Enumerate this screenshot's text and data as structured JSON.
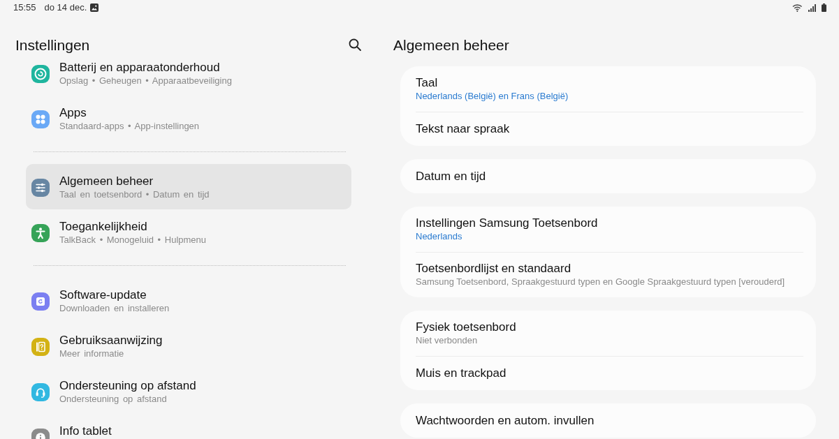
{
  "status_bar": {
    "time": "15:55",
    "date": "do 14 dec."
  },
  "sidebar": {
    "title": "Instellingen",
    "groups": [
      {
        "items": [
          {
            "title": "Batterij en apparaatonderhoud",
            "subtitle": "Opslag • Geheugen • Apparaatbeveiliging",
            "selected": false
          },
          {
            "title": "Apps",
            "subtitle": "Standaard-apps • App-instellingen",
            "selected": false
          }
        ]
      },
      {
        "items": [
          {
            "title": "Algemeen beheer",
            "subtitle": "Taal en toetsenbord • Datum en tijd",
            "selected": true
          },
          {
            "title": "Toegankelijkheid",
            "subtitle": "TalkBack • Monogeluid • Hulpmenu",
            "selected": false
          }
        ]
      },
      {
        "items": [
          {
            "title": "Software-update",
            "subtitle": "Downloaden en installeren",
            "selected": false
          },
          {
            "title": "Gebruiksaanwijzing",
            "subtitle": "Meer informatie",
            "selected": false
          },
          {
            "title": "Ondersteuning op afstand",
            "subtitle": "Ondersteuning op afstand",
            "selected": false
          },
          {
            "title": "Info tablet",
            "selected": false
          }
        ]
      }
    ]
  },
  "detail": {
    "title": "Algemeen beheer",
    "cards": [
      {
        "rows": [
          {
            "kind": "value",
            "title": "Taal",
            "subtitle": "Nederlands (België) en Frans (België)"
          },
          {
            "kind": "single",
            "title": "Tekst naar spraak"
          }
        ]
      },
      {
        "rows": [
          {
            "kind": "single",
            "title": "Datum en tijd"
          }
        ]
      },
      {
        "rows": [
          {
            "kind": "value",
            "title": "Instellingen Samsung Toetsenbord",
            "subtitle": "Nederlands"
          },
          {
            "kind": "summary",
            "title": "Toetsenbordlijst en standaard",
            "subtitle": "Samsung Toetsenbord, Spraakgestuurd typen en Google Spraakgestuurd typen [verouderd]"
          }
        ]
      },
      {
        "rows": [
          {
            "kind": "summary",
            "title": "Fysiek toetsenbord",
            "subtitle": "Niet verbonden"
          },
          {
            "kind": "single",
            "title": "Muis en trackpad"
          }
        ]
      },
      {
        "rows": [
          {
            "kind": "single",
            "title": "Wachtwoorden en autom. invullen"
          }
        ]
      }
    ]
  }
}
